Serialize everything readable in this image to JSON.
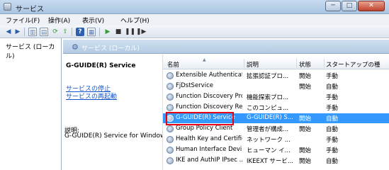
{
  "window": {
    "title": "サービス",
    "buttons": [
      "─",
      "□",
      "✕"
    ]
  },
  "menu": [
    "ファイル(F)",
    "操作(A)",
    "表示(V)",
    "ヘルプ(H)"
  ],
  "toolbar": {
    "icons": [
      "back-arrow-icon",
      "forward-arrow-icon",
      "console-tree-icon",
      "properties-icon",
      "refresh-icon",
      "export-list-icon",
      "help-icon",
      "view-icon",
      "start-service-icon",
      "stop-service-icon",
      "pause-service-icon",
      "restart-service-icon"
    ]
  },
  "tree": {
    "root": "サービス (ローカル)"
  },
  "main_header": {
    "title": "サービス (ローカル)"
  },
  "detail": {
    "service_title": "G-GUIDE(R) Service",
    "link_stop": "サービスの停止",
    "link_restart": "サービスの再起動",
    "desc_label": "説明:",
    "desc_text": "G-GUIDE(R) Service for Windows"
  },
  "list": {
    "columns": [
      "名前",
      "説明",
      "状態",
      "スタートアップの種"
    ],
    "rows": [
      {
        "name": "Extensible Authenticati...",
        "desc": "拡張認証プロ...",
        "status": "開始",
        "startup": "手動"
      },
      {
        "name": "FjDstService",
        "desc": "",
        "status": "開始",
        "startup": "自動"
      },
      {
        "name": "Function Discovery Pro...",
        "desc": "機能探索プロ...",
        "status": "",
        "startup": "手動"
      },
      {
        "name": "Function Discovery Re...",
        "desc": "このコンピュ...",
        "status": "",
        "startup": "手動"
      },
      {
        "name": "G-GUIDE(R) Service",
        "desc": "G-GUIDE(R) S...",
        "status": "開始",
        "startup": "自動"
      },
      {
        "name": "Group Policy Client",
        "desc": "管理者が構成...",
        "status": "開始",
        "startup": "自動"
      },
      {
        "name": "Health Key and Certific...",
        "desc": "ネットワーク ...",
        "status": "",
        "startup": "手動"
      },
      {
        "name": "Human Interface Devi...",
        "desc": "ヒューマン イ...",
        "status": "開始",
        "startup": "手動"
      },
      {
        "name": "IKE and AuthIP IPsec ...",
        "desc": "IKEEXT サービ...",
        "status": "開始",
        "startup": "自動"
      }
    ],
    "selected_index": 4
  }
}
